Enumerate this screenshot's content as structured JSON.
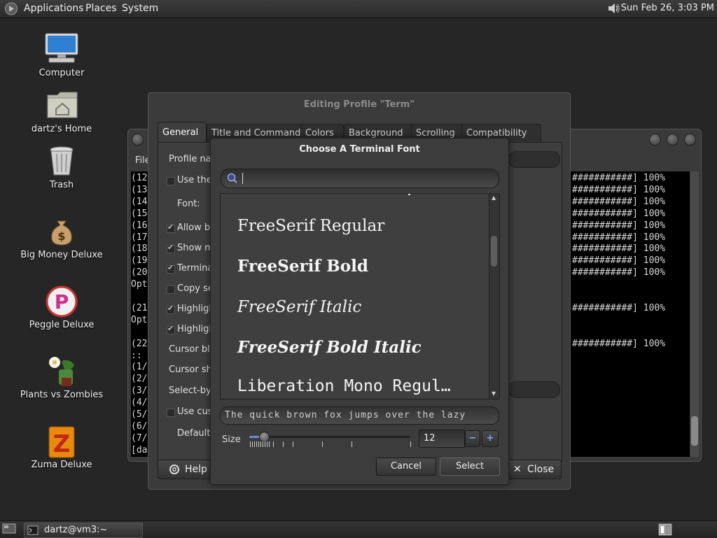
{
  "top_panel": {
    "applications": "Applications",
    "places": "Places",
    "system": "System",
    "clock": "Sun Feb 26,  3:03 PM"
  },
  "desktop": {
    "icons": [
      {
        "label": "Computer",
        "icon": "computer-icon"
      },
      {
        "label": "dartz's Home",
        "icon": "home-folder-icon"
      },
      {
        "label": "Trash",
        "icon": "trash-icon"
      },
      {
        "label": "Big Money Deluxe",
        "icon": "money-bag-icon"
      },
      {
        "label": "Peggle Deluxe",
        "icon": "peggle-icon"
      },
      {
        "label": "Plants vs Zombies",
        "icon": "plants-vs-zombies-icon"
      },
      {
        "label": "Zuma Deluxe",
        "icon": "zuma-icon"
      }
    ]
  },
  "terminal": {
    "menu_first": "File",
    "left_lines": [
      "(12",
      "(13",
      "(14",
      "(15",
      "(16",
      "(17",
      "(18",
      "(19",
      "(20",
      "Opt",
      "",
      "(21",
      "Opt",
      "",
      "(22",
      "::",
      "(1/",
      "(2/",
      "(3/",
      "(4/",
      "(5/",
      "(6/",
      "(7/",
      "[da"
    ],
    "progress_text": "###########] 100%"
  },
  "profile_dialog": {
    "title": "Editing Profile \"Term\"",
    "tabs": [
      "General",
      "Title and Command",
      "Colors",
      "Background",
      "Scrolling",
      "Compatibility"
    ],
    "rows": [
      {
        "label": "Profile nar",
        "checkbox": null
      },
      {
        "label": "Use the",
        "checkbox": false
      },
      {
        "label": "Font:",
        "checkbox": null
      },
      {
        "label": "Allow bo",
        "checkbox": true
      },
      {
        "label": "Show m",
        "checkbox": true
      },
      {
        "label": "Termina",
        "checkbox": true
      },
      {
        "label": "Copy se",
        "checkbox": false
      },
      {
        "label": "Highligh",
        "checkbox": true
      },
      {
        "label": "Highligh",
        "checkbox": true
      },
      {
        "label": "Cursor blii",
        "checkbox": null
      },
      {
        "label": "Cursor sha",
        "checkbox": null
      },
      {
        "label": "Select-by-",
        "checkbox": null
      },
      {
        "label": "Use cust",
        "checkbox": false
      },
      {
        "label": "Default",
        "checkbox": null
      }
    ],
    "help": "Help",
    "close": "Close"
  },
  "font_chooser": {
    "title": "Choose A Terminal Font",
    "search_value": "",
    "fonts": [
      {
        "name": "FreeSerif Regular",
        "style": "regular"
      },
      {
        "name": "FreeSerif Bold",
        "style": "bold"
      },
      {
        "name": "FreeSerif Italic",
        "style": "italic"
      },
      {
        "name": "FreeSerif Bold Italic",
        "style": "bold-italic"
      },
      {
        "name": "Liberation Mono Regul…",
        "style": "mono"
      }
    ],
    "preview_text": "The quick brown fox jumps over the lazy",
    "size_label": "Size",
    "size_value": "12",
    "minus": "−",
    "plus": "+",
    "cancel": "Cancel",
    "select": "Select"
  },
  "bottom_panel": {
    "task": "dartz@vm3:~"
  }
}
